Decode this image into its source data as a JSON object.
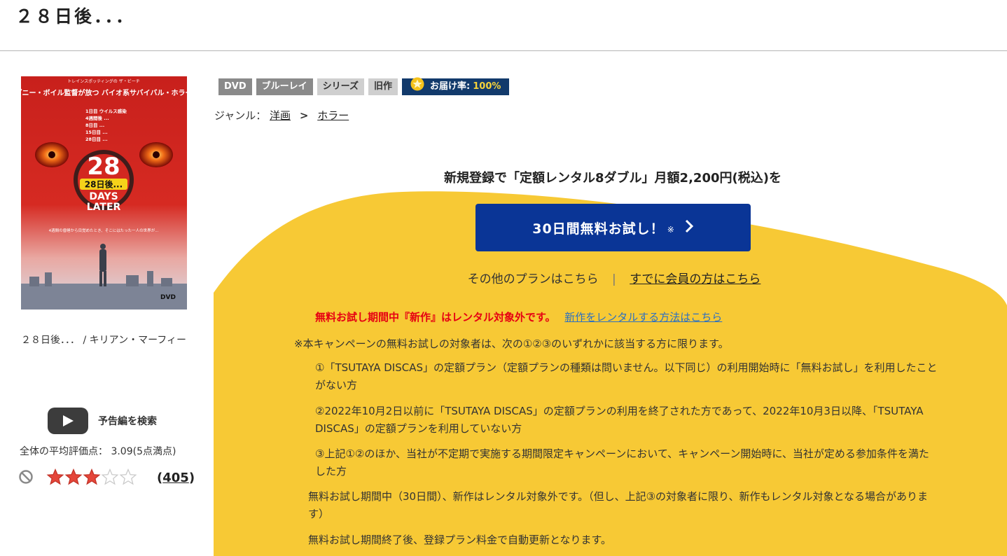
{
  "title": "２８日後．．．",
  "poster": {
    "top_text": "トレインスポッティングの ザ・ビーチ",
    "tagline": "ダニー・ボイル監督が放つ バイオ系サバイバル・ホラー",
    "timeline": [
      "1日目 ウイルス感染",
      "4週間後 ...",
      "8日目 ...",
      "15日目 ...",
      "28日目 ..."
    ],
    "big_number": "28",
    "logo_jp": "28日後...",
    "logo_en_1": "DAYS",
    "logo_en_2": "LATER",
    "bottom_text": "4週間の昏睡から目覚めたとき、そこにはたった一人の世界が...",
    "format": "DVD"
  },
  "left": {
    "caption": "２８日後．．． / キリアン・マーフィー",
    "trailer_label": "予告編を検索",
    "avg_rating": "全体の平均評価点： 3.09(5点満点)",
    "stars_filled": 3,
    "stars_total": 5,
    "review_count_open": "(",
    "review_count": "405",
    "review_count_close": ")"
  },
  "badges": {
    "dvd": "DVD",
    "bluray": "ブルーレイ",
    "series": "シリーズ",
    "old": "旧作",
    "delivery_label": "お届け率:",
    "delivery_rate": "100%"
  },
  "genre": {
    "label": "ジャンル：",
    "g1": "洋画",
    "sep": ">",
    "g2": "ホラー"
  },
  "promo": {
    "lead": "新規登録で「定額レンタル8ダブル」月額2,200円(税込)を",
    "cta_label": "30日間無料お試し！",
    "cta_note": "※",
    "other_plans": "その他のプランはこちら",
    "divider": "|",
    "members": "すでに会員の方はこちら",
    "warn": "無料お試し期間中『新作』はレンタル対象外です。",
    "warn_link": "新作をレンタルする方法はこちら",
    "camp_intro": "※本キャンペーンの無料お試しの対象者は、次の①②③のいずれかに該当する方に限ります。",
    "cond1": "①「TSUTAYA DISCAS」の定額プラン（定額プランの種類は問いません。以下同じ）の利用開始時に「無料お試し」を利用したことがない方",
    "cond2": "②2022年10月2日以前に「TSUTAYA DISCAS」の定額プランの利用を終了された方であって、2022年10月3日以降、「TSUTAYA DISCAS」の定額プランを利用していない方",
    "cond3": "③上記①②のほか、当社が不定期で実施する期間限定キャンペーンにおいて、キャンペーン開始時に、当社が定める参加条件を満たした方",
    "para1": "無料お試し期間中（30日間）、新作はレンタル対象外です。（但し、上記③の対象者に限り、新作もレンタル対象となる場合があります）",
    "para2": "無料お試し期間終了後、登録プラン料金で自動更新となります。"
  },
  "colors": {
    "promo_yellow": "#f7c935",
    "cta_blue": "#0a3596",
    "warn_red": "#e60012",
    "link_blue": "#2c70c2",
    "delivery_navy": "#123a6b",
    "star_red": "#e5463a"
  }
}
